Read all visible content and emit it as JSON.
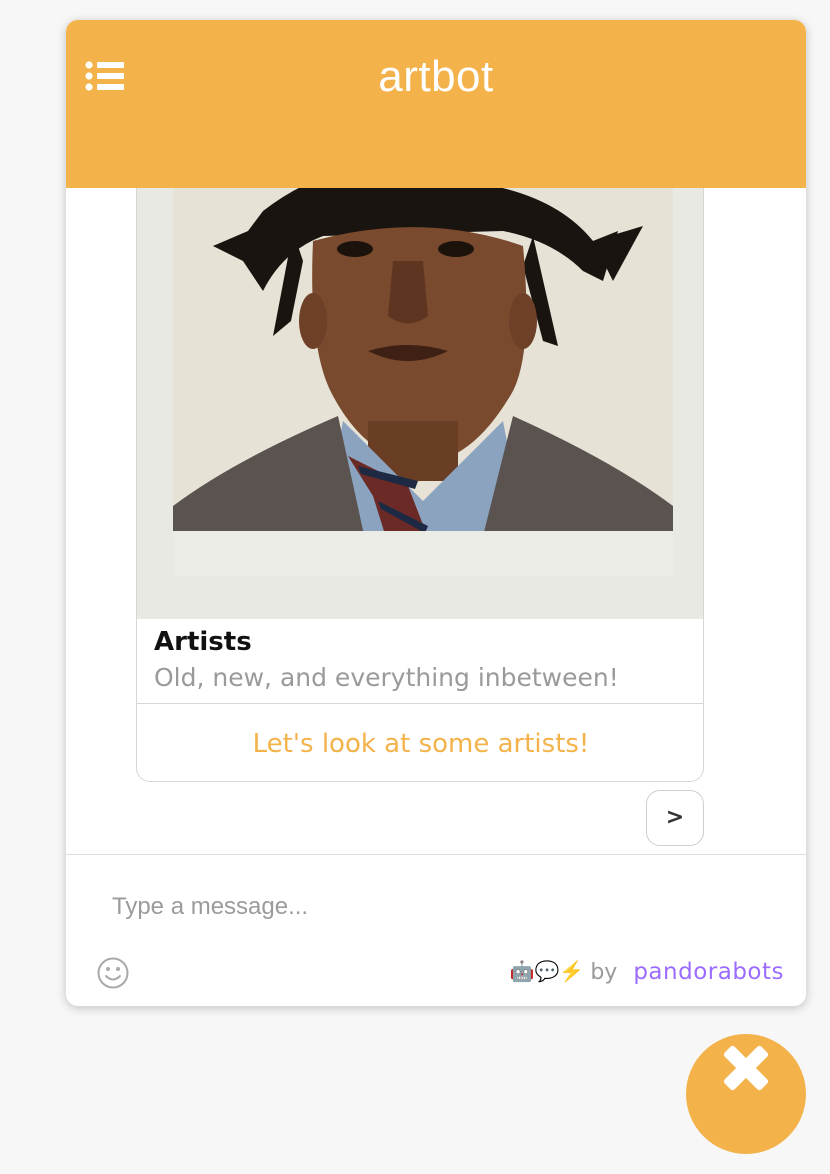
{
  "header": {
    "title": "artbot",
    "menu_icon": "list-icon"
  },
  "card": {
    "title": "Artists",
    "subtitle": "Old, new, and everything inbetween!",
    "button_label": "Let's look at some artists!"
  },
  "next_button_label": ">",
  "composer": {
    "placeholder": "Type a message...",
    "emoji_icon": "smiley-icon"
  },
  "credit": {
    "emojis": "🤖💬⚡",
    "by": "by",
    "brand": "pandorabots"
  },
  "close_icon": "close-icon",
  "colors": {
    "accent": "#f4b24b",
    "brand": "#9b6cff"
  }
}
